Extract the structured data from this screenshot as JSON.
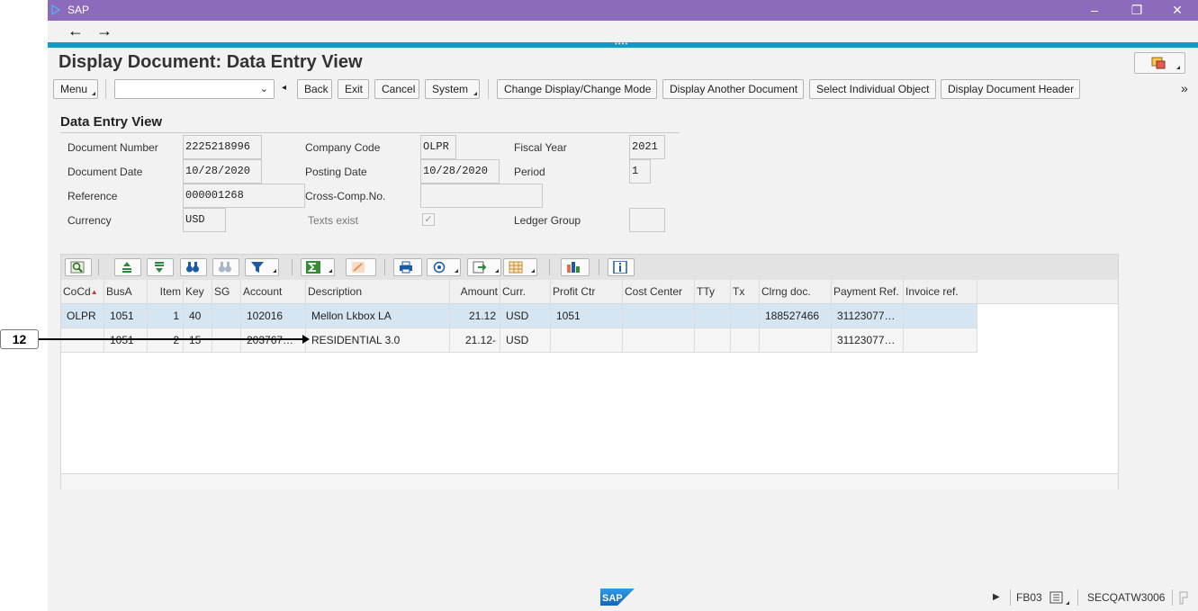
{
  "window": {
    "app_name": "SAP",
    "buttons": [
      "–",
      "❐",
      "✕"
    ]
  },
  "nav": {
    "back": "←",
    "forward": "→"
  },
  "page_title": "Display Document: Data Entry View",
  "toolbar": {
    "menu": "Menu",
    "back": "Back",
    "exit": "Exit",
    "cancel": "Cancel",
    "system": "System",
    "change_display": "Change Display/Change Mode",
    "display_another": "Display Another Document",
    "select_object": "Select Individual Object",
    "display_header": "Display Document Header",
    "more": "»",
    "command_placeholder": ""
  },
  "section_title": "Data Entry View",
  "fields": {
    "doc_number_label": "Document Number",
    "doc_number": "2225218996",
    "company_code_label": "Company Code",
    "company_code": "OLPR",
    "fiscal_year_label": "Fiscal Year",
    "fiscal_year": "2021",
    "doc_date_label": "Document Date",
    "doc_date": "10/28/2020",
    "posting_date_label": "Posting Date",
    "posting_date": "10/28/2020",
    "period_label": "Period",
    "period": "1",
    "reference_label": "Reference",
    "reference": "000001268",
    "cross_comp_label": "Cross-Comp.No.",
    "cross_comp": "",
    "currency_label": "Currency",
    "currency": "USD",
    "texts_exist_label": "Texts exist",
    "texts_exist_check": "✓",
    "ledger_group_label": "Ledger Group",
    "ledger_group": ""
  },
  "grid": {
    "columns": [
      "CoCd",
      "BusA",
      "Item",
      "Key",
      "SG",
      "Account",
      "Description",
      "Amount",
      "Curr.",
      "Profit Ctr",
      "Cost Center",
      "TTy",
      "Tx",
      "Clrng doc.",
      "Payment Ref.",
      "Invoice ref."
    ],
    "sort_indicator": "▲",
    "rows": [
      [
        "OLPR",
        "1051",
        "1",
        "40",
        "",
        "102016",
        "Mellon Lkbox LA",
        "21.12",
        "USD",
        "1051",
        "",
        "",
        "",
        "188527466",
        "31123077…",
        ""
      ],
      [
        "",
        "1051",
        "2",
        "15",
        "",
        "203767…",
        "RESIDENTIAL 3.0",
        "21.12-",
        "USD",
        "",
        "",
        "",
        "",
        "",
        "31123077…",
        ""
      ]
    ]
  },
  "callout": {
    "label": "12"
  },
  "status": {
    "transaction": "FB03",
    "system": "SECQATW3006",
    "play": "▶"
  },
  "colors": {
    "titlebar": "#8c6bbd",
    "accent_bar": "#1797c4",
    "row_selected": "#d5e6f2"
  }
}
